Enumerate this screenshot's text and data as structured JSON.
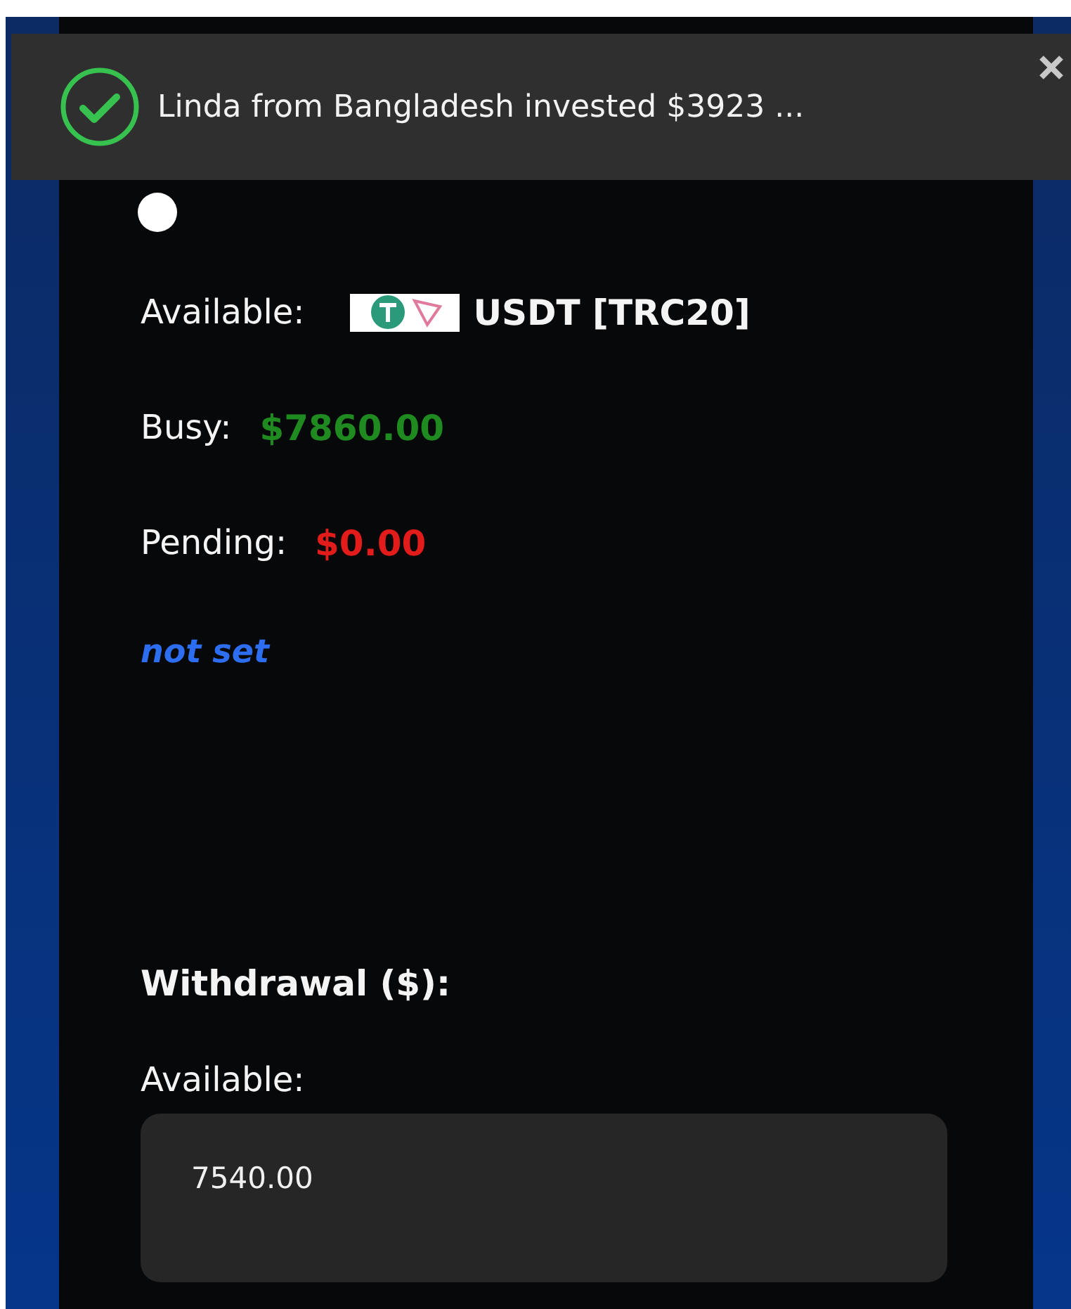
{
  "toast": {
    "message": "Linda from Bangladesh invested $3923 ..."
  },
  "wallet": {
    "currency_label": "Available:",
    "currency": "USDT [TRC20]",
    "balances": [
      {
        "label": "Busy:",
        "amount": "$7860.00",
        "color": "#1f8a1f"
      },
      {
        "label": "Pending:",
        "amount": "$0.00",
        "color": "#e21b1b"
      }
    ],
    "address": "not set"
  },
  "withdrawal": {
    "title": "Withdrawal ($):",
    "available_label": "Available:",
    "available_value": "7540.00"
  }
}
